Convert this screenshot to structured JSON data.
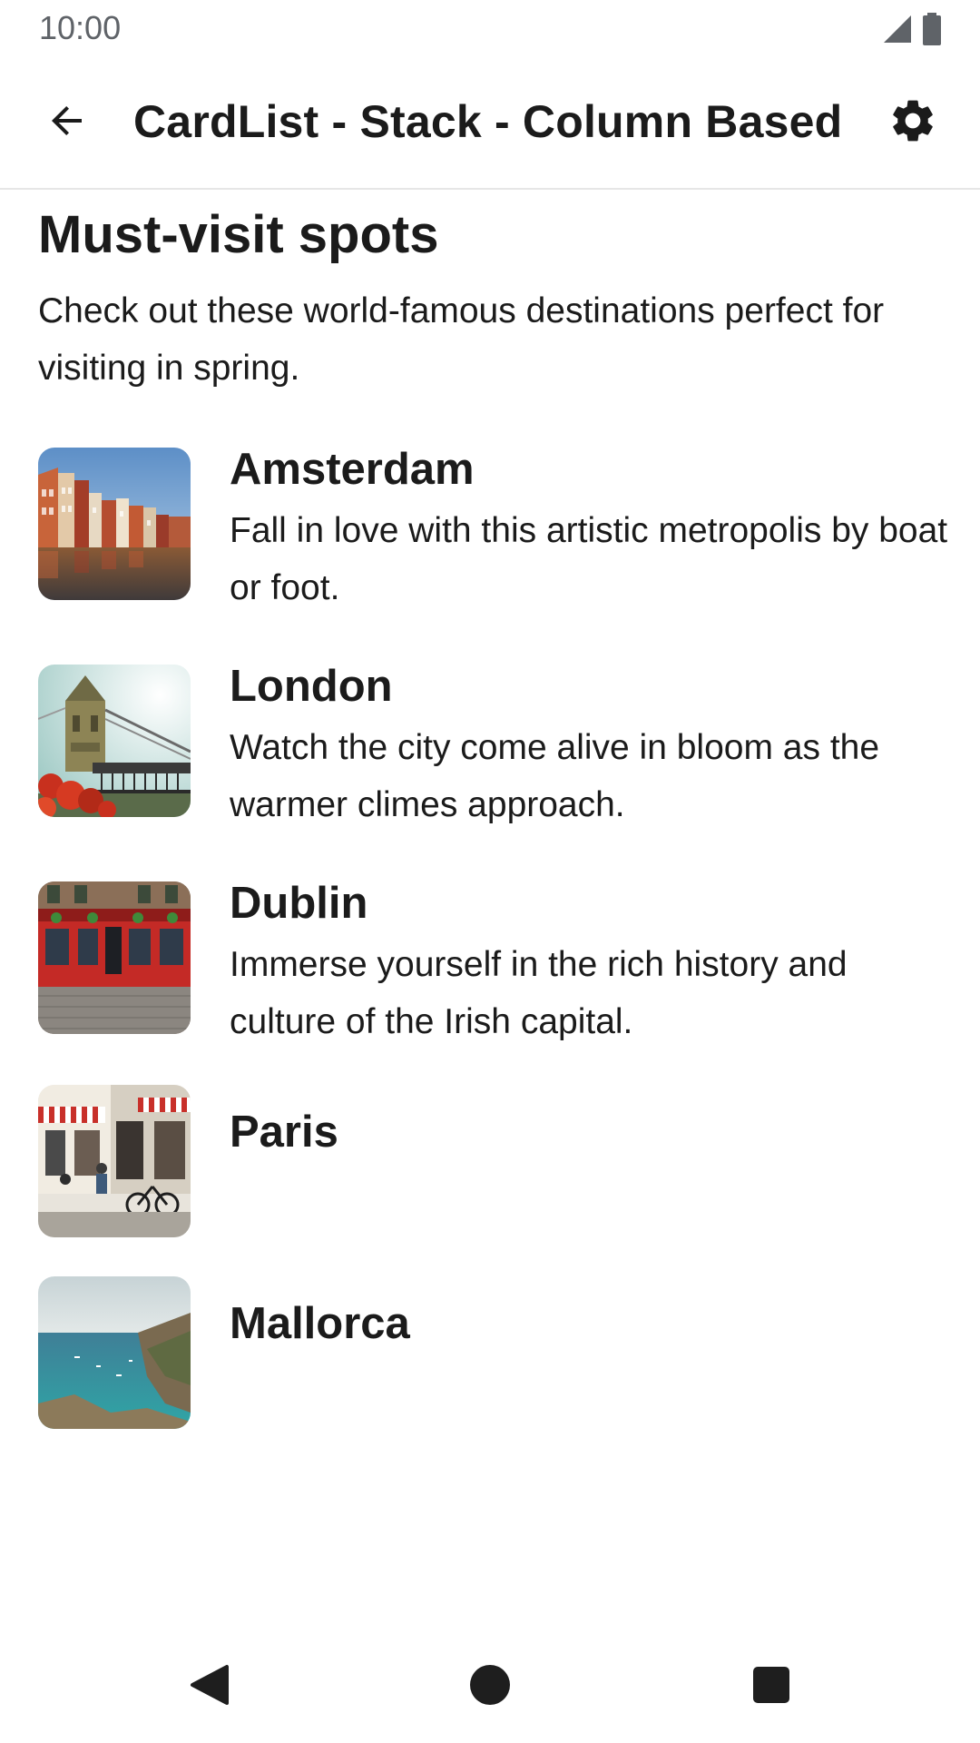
{
  "status_bar": {
    "time": "10:00",
    "icons": [
      "signal-icon",
      "battery-icon"
    ]
  },
  "app_bar": {
    "title": "CardList - Stack - Column Based",
    "back_icon": "arrow-back-icon",
    "settings_icon": "gear-icon"
  },
  "section": {
    "title": "Must-visit spots",
    "description": "Check out these world-famous destinations perfect for visiting in spring."
  },
  "cards": [
    {
      "title": "Amsterdam",
      "description": "Fall in love with this artistic metropolis by boat or foot.",
      "image": "amsterdam-canal-houses"
    },
    {
      "title": "London",
      "description": "Watch the city come alive in bloom as the warmer climes approach.",
      "image": "tower-bridge"
    },
    {
      "title": "Dublin",
      "description": "Immerse yourself in the rich history and culture of the Irish capital.",
      "image": "temple-bar-pub"
    },
    {
      "title": "Paris",
      "description": "",
      "image": "paris-cafe-street"
    },
    {
      "title": "Mallorca",
      "description": "",
      "image": "mallorca-coast"
    }
  ],
  "nav_bar": {
    "icons": [
      "nav-back-icon",
      "nav-home-icon",
      "nav-recents-icon"
    ]
  },
  "colors": {
    "text_primary": "#1b1b1b",
    "status_text": "#5f6368",
    "divider": "#e6e6e6",
    "background": "#ffffff"
  }
}
